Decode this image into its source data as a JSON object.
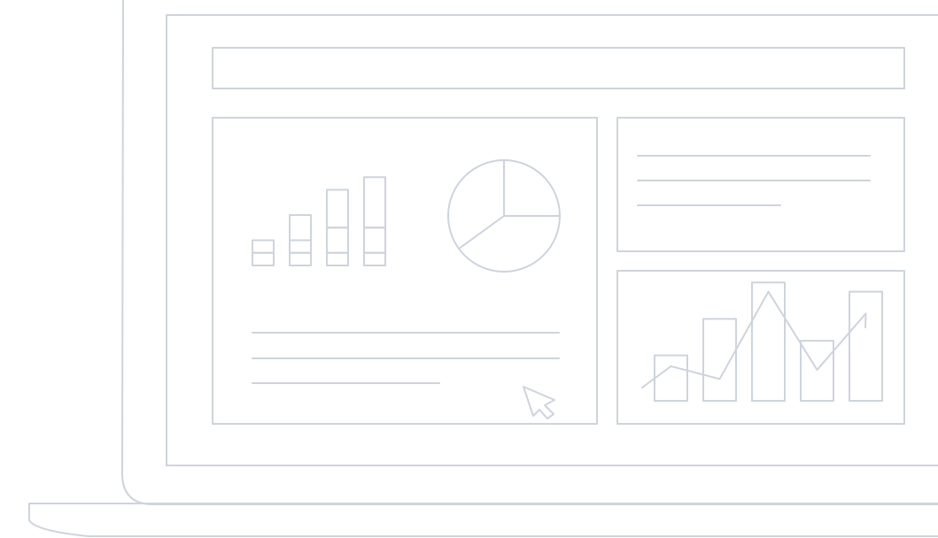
{
  "colors": {
    "background": "#ffffff",
    "line": "#cdd4dd"
  },
  "illustration": {
    "subject": "laptop",
    "screen": "dashboard",
    "icons": [
      "laptop-icon",
      "stacked-bar-chart-icon",
      "pie-chart-icon",
      "bar-line-chart-icon",
      "cursor-icon"
    ]
  },
  "chart_data": [
    {
      "type": "bar",
      "stacked": true,
      "categories": [
        "",
        "",
        "",
        ""
      ],
      "series": [
        {
          "values": [
            1,
            1,
            1,
            1
          ]
        },
        {
          "values": [
            1,
            1,
            2,
            2
          ]
        },
        {
          "values": [
            0,
            2,
            3,
            4
          ]
        }
      ],
      "ylim": [
        0,
        8
      ],
      "grid": false,
      "xlabel": "",
      "ylabel": "",
      "title": ""
    },
    {
      "type": "pie",
      "values": [
        25,
        40,
        35
      ],
      "title": ""
    },
    {
      "type": "bar",
      "categories": [
        "",
        "",
        "",
        "",
        ""
      ],
      "series": [
        {
          "type": "bar",
          "values": [
            2.5,
            4.5,
            6.5,
            3.3,
            6.0
          ]
        },
        {
          "type": "line",
          "values": [
            1.9,
            1.2,
            6.0,
            1.7,
            4.8
          ]
        }
      ],
      "ylim": [
        0,
        7
      ],
      "grid": false,
      "xlabel": "",
      "ylabel": "",
      "title": ""
    }
  ]
}
